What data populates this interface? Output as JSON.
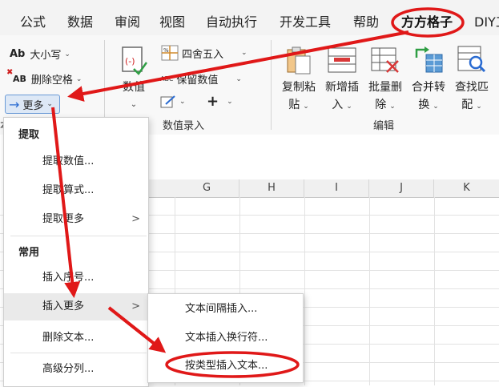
{
  "menubar": {
    "tabs": [
      {
        "id": "formula",
        "label": "公式"
      },
      {
        "id": "data",
        "label": "数据"
      },
      {
        "id": "review",
        "label": "审阅"
      },
      {
        "id": "view",
        "label": "视图"
      },
      {
        "id": "auto",
        "label": "自动执行"
      },
      {
        "id": "dev",
        "label": "开发工具"
      },
      {
        "id": "help",
        "label": "帮助"
      },
      {
        "id": "fangfang",
        "label": "方方格子"
      },
      {
        "id": "diy",
        "label": "DIY工"
      }
    ]
  },
  "ribbon": {
    "small_buttons": {
      "case": "大小写",
      "case_icon_text": "Ab",
      "remove_space": "删除空格",
      "remove_space_icon_text": "AB",
      "more": "更多"
    },
    "numeric": {
      "value_button": "数值",
      "round_button": "四舍五入",
      "keep_value_button": "保留数值",
      "keep_value_icon_text": "ABC",
      "group_label": "数值录入"
    },
    "edit": {
      "copy_paste": [
        "复制粘",
        "贴"
      ],
      "insert": [
        "新增插",
        "入"
      ],
      "batch_delete": [
        "批量删",
        "除"
      ],
      "merge_convert": [
        "合并转",
        "换"
      ],
      "find_match": [
        "查找匹",
        "配"
      ],
      "group_label": "编辑"
    },
    "clipped_group_label": "本"
  },
  "sheet": {
    "columns": [
      "G",
      "H",
      "I",
      "J",
      "K"
    ]
  },
  "dropdown": {
    "section_extract": "提取",
    "extract_items": [
      "提取数值...",
      "提取算式...",
      "提取更多"
    ],
    "section_common": "常用",
    "common_items": [
      "插入序号...",
      "插入更多",
      "删除文本...",
      "高级分列..."
    ]
  },
  "submenu": {
    "items": [
      "文本间隔插入...",
      "文本插入换行符...",
      "按类型插入文本..."
    ]
  },
  "colors": {
    "annotation_red": "#e01818",
    "more_button_bg": "#dde8f6",
    "more_button_border": "#6a9ad6",
    "menubar_bg": "#f3f3f3"
  }
}
